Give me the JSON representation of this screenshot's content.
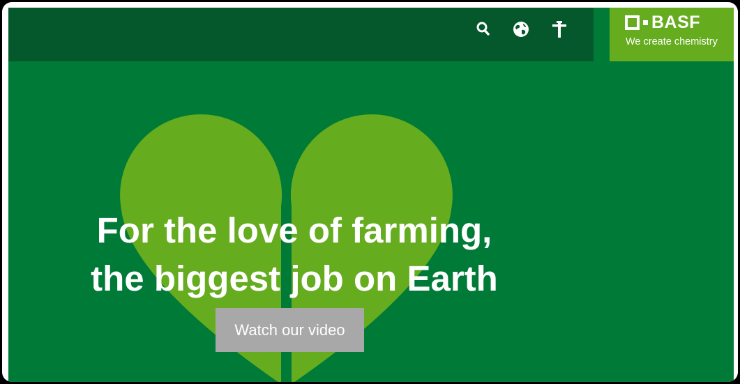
{
  "brand": {
    "name": "BASF",
    "tagline": "We create chemistry"
  },
  "hero": {
    "headline_line1": "For the love of farming,",
    "headline_line2": "the biggest job on Earth",
    "cta_label": "Watch our video"
  },
  "nav": {
    "icons": [
      "search-icon",
      "globe-icon",
      "person-icon"
    ]
  },
  "colors": {
    "hero_background": "#007a37",
    "top_bar": "#05572c",
    "logo_background": "#65ac1e",
    "heart": "#65ac1e",
    "cta_background": "#a8a8a8"
  }
}
